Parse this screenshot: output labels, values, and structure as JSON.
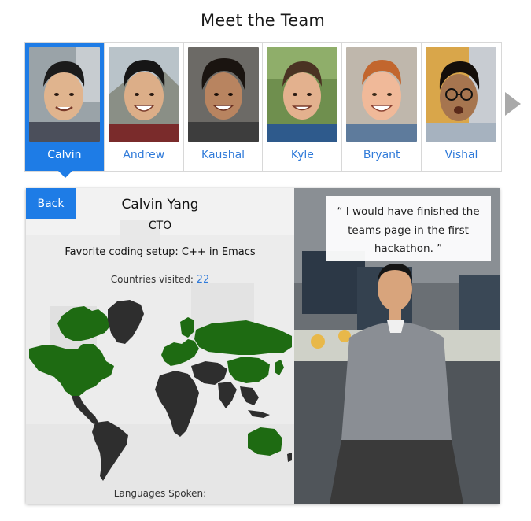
{
  "page": {
    "title": "Meet the Team"
  },
  "members": [
    {
      "name": "Calvin",
      "selected": true
    },
    {
      "name": "Andrew"
    },
    {
      "name": "Kaushal"
    },
    {
      "name": "Kyle"
    },
    {
      "name": "Bryant"
    },
    {
      "name": "Vishal"
    }
  ],
  "detail": {
    "back_label": "Back",
    "full_name": "Calvin Yang",
    "role": "CTO",
    "coding_setup": "Favorite coding setup: C++ in Emacs",
    "countries_label": "Countries visited:",
    "countries_count": "22",
    "languages_label": "Languages Spoken:",
    "quote": "“ I would have finished the teams page in the first hackathon. ”"
  },
  "colors": {
    "accent": "#1e7ce6",
    "link": "#2f7ad9",
    "visited_country": "#1e6b12",
    "unvisited_country": "#2e2e2e"
  },
  "icons": {
    "next": "chevron-right-icon"
  }
}
